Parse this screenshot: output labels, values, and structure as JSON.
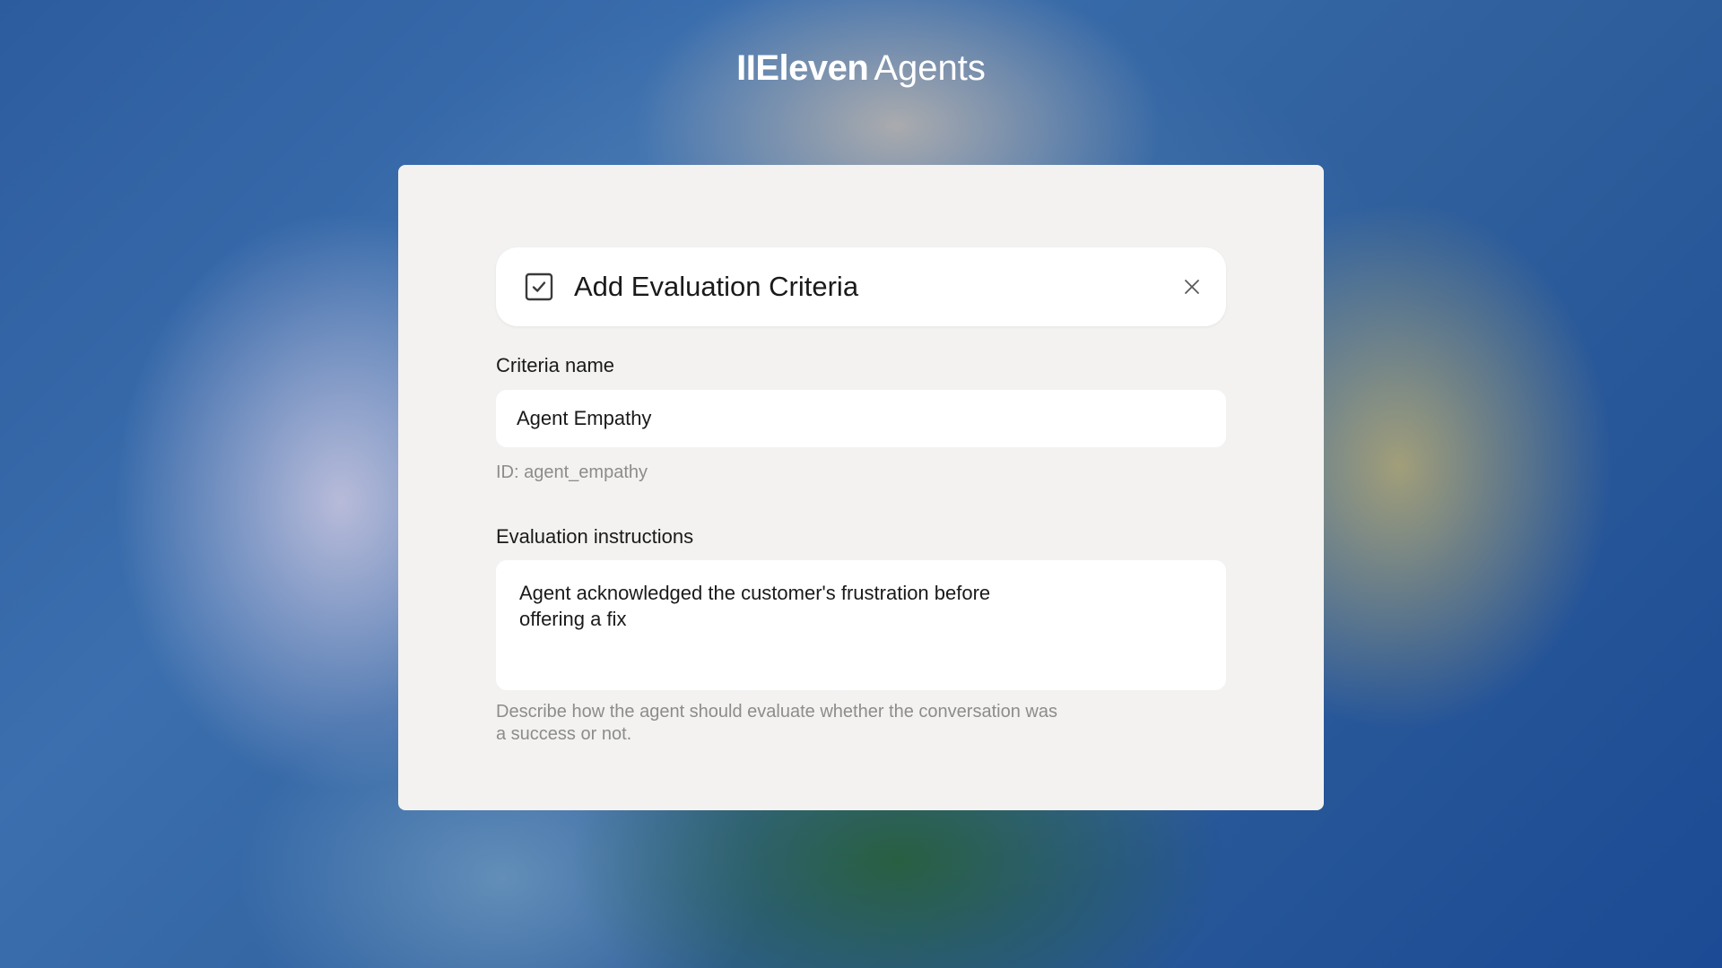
{
  "brand": {
    "logo": "IIEleven",
    "product": "Agents"
  },
  "dialog": {
    "title": "Add Evaluation Criteria",
    "criteria_name": {
      "label": "Criteria name",
      "value": "Agent Empathy",
      "id_hint": "ID: agent_empathy"
    },
    "instructions": {
      "label": "Evaluation instructions",
      "value": "Agent acknowledged the customer's frustration before offering a fix",
      "helper": "Describe how the agent should evaluate whether the conversation was a success or not."
    }
  },
  "icons": {
    "header": "checkbox-checked-icon",
    "close": "close-icon"
  }
}
